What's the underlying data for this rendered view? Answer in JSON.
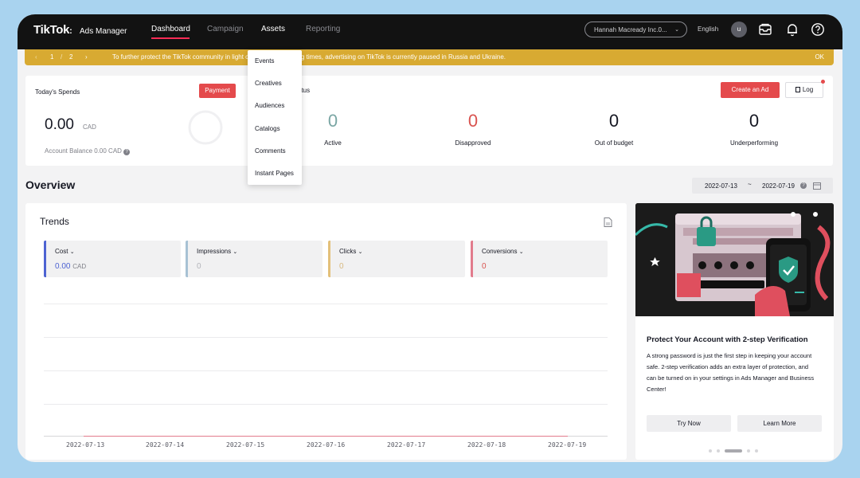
{
  "app": {
    "logo": "TikTok",
    "logo_sub": "Ads Manager"
  },
  "nav": {
    "items": [
      {
        "label": "Dashboard",
        "state": "active"
      },
      {
        "label": "Campaign",
        "state": "normal"
      },
      {
        "label": "Assets",
        "state": "hover"
      },
      {
        "label": "Reporting",
        "state": "normal"
      }
    ]
  },
  "header_right": {
    "account": "Hannah Macready Inc.0...",
    "language": "English",
    "avatar_letter": "u",
    "icons": [
      "inbox-icon",
      "bell-icon",
      "help-icon"
    ]
  },
  "banner": {
    "page_current": "1",
    "page_sep": "/",
    "page_total": "2",
    "message": "To further protect the TikTok community in light of ... [obscured] ...g times, advertising on TikTok is currently paused in Russia and Ukraine.",
    "message_left": "To further protect the TikTok community in light o",
    "message_right": "g times, advertising on TikTok is currently paused in Russia and Ukraine.",
    "ok": "OK"
  },
  "assets_menu": [
    "Events",
    "Creatives",
    "Audiences",
    "Catalogs",
    "Comments",
    "Instant Pages"
  ],
  "spends": {
    "title": "Today's Spends",
    "payment_btn": "Payment",
    "amount": "0.00",
    "currency": "CAD",
    "balance": "Account Balance 0.00 CAD"
  },
  "ad_status": {
    "title_partial": "atus",
    "create_btn": "Create an Ad",
    "log_btn": "Log",
    "stats": [
      {
        "label": "Active",
        "value": "0",
        "color": "#7aa6a4"
      },
      {
        "label": "Disapproved",
        "value": "0",
        "color": "#d9534f"
      },
      {
        "label": "Out of budget",
        "value": "0",
        "color": "#161823"
      },
      {
        "label": "Underperforming",
        "value": "0",
        "color": "#161823"
      }
    ]
  },
  "overview": {
    "title": "Overview",
    "date_from": "2022-07-13",
    "date_sep": "~",
    "date_to": "2022-07-19"
  },
  "trends": {
    "title": "Trends",
    "metrics": [
      {
        "name": "Cost",
        "value": "0.00",
        "unit": "CAD",
        "color": "#4d63d2",
        "value_color": "#4d63d2"
      },
      {
        "name": "Impressions",
        "value": "0",
        "unit": "",
        "color": "#a7c1d4",
        "value_color": "#b3b4ba"
      },
      {
        "name": "Clicks",
        "value": "0",
        "unit": "",
        "color": "#e3c07a",
        "value_color": "#d8b980"
      },
      {
        "name": "Conversions",
        "value": "0",
        "unit": "",
        "color": "#e27b8c",
        "value_color": "#d9534f"
      }
    ],
    "x_dates": [
      "2022-07-13",
      "2022-07-14",
      "2022-07-15",
      "2022-07-16",
      "2022-07-17",
      "2022-07-18",
      "2022-07-19"
    ]
  },
  "promo": {
    "title": "Protect Your Account with 2-step Verification",
    "body": "A strong password is just the first step in keeping your account safe. 2-step verification adds an extra layer of protection, and can be turned on in your settings in Ads Manager and Business Center!",
    "try_btn": "Try Now",
    "learn_btn": "Learn More"
  }
}
